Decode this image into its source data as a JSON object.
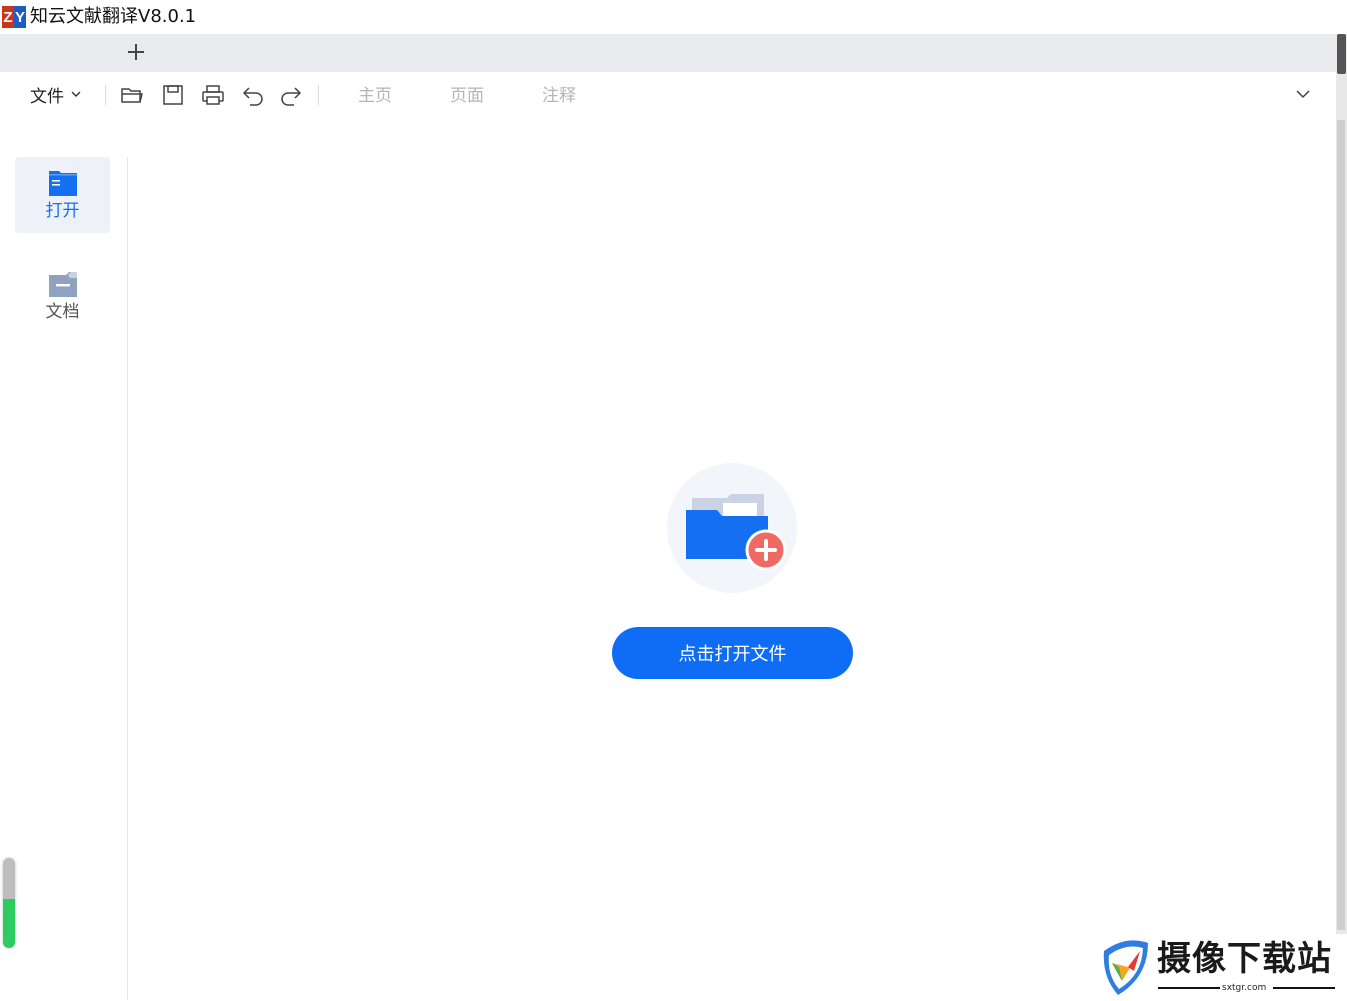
{
  "window": {
    "title": "知云文献翻译V8.0.1",
    "logo_letters": [
      "Z",
      "Y"
    ]
  },
  "tabstrip": {
    "new_tab_icon": "plus-icon"
  },
  "toolbar": {
    "file_menu_label": "文件",
    "icons": [
      "folder-open-icon",
      "save-icon",
      "print-icon",
      "undo-icon",
      "redo-icon"
    ],
    "tabs": [
      {
        "label": "主页",
        "enabled": false
      },
      {
        "label": "页面",
        "enabled": false
      },
      {
        "label": "注释",
        "enabled": false
      }
    ],
    "collapse_icon": "chevron-down-icon"
  },
  "sidebar": {
    "items": [
      {
        "label": "打开",
        "icon": "folder-icon",
        "active": true
      },
      {
        "label": "文档",
        "icon": "document-icon",
        "active": false
      }
    ]
  },
  "main": {
    "empty_state_icon": "folder-add-icon",
    "open_button_label": "点击打开文件"
  },
  "meter": {
    "fill_fraction": 0.55
  },
  "watermark": {
    "text": "摄像下载站",
    "url": "sxtgr.com"
  },
  "colors": {
    "accent": "#0f6cf5",
    "add_badge": "#f06a64",
    "tab_disabled": "#b5b5b5"
  }
}
